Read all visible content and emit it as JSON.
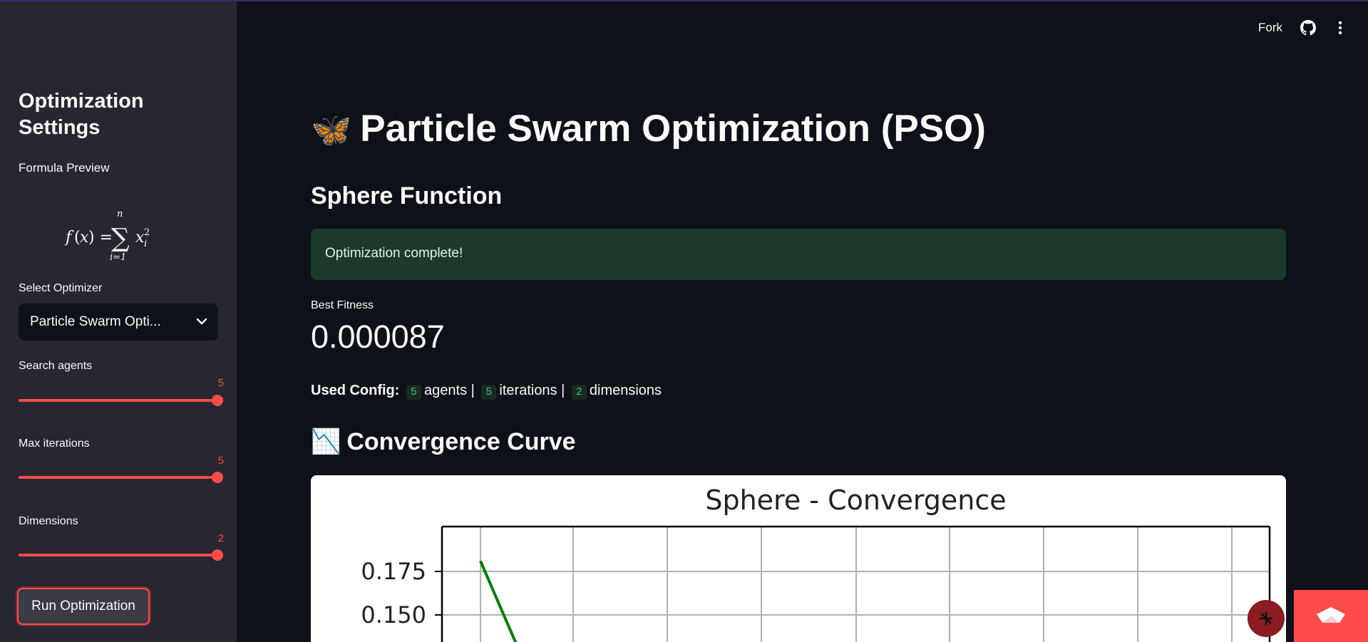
{
  "header": {
    "fork_label": "Fork"
  },
  "sidebar": {
    "title": "Optimization Settings",
    "formula_label": "Formula Preview",
    "select_label": "Select Optimizer",
    "select_value": "Particle Swarm Opti...",
    "sliders": [
      {
        "label": "Search agents",
        "value": "5"
      },
      {
        "label": "Max iterations",
        "value": "5"
      },
      {
        "label": "Dimensions",
        "value": "2"
      }
    ],
    "run_button": "Run Optimization"
  },
  "main": {
    "title_emoji": "🦋",
    "title": "Particle Swarm Optimization (PSO)",
    "subtitle": "Sphere Function",
    "alert": "Optimization complete!",
    "metric_label": "Best Fitness",
    "metric_value": "0.000087",
    "config": {
      "label": "Used Config:",
      "agents": "5",
      "agents_label": "agents |",
      "iterations": "5",
      "iterations_label": "iterations |",
      "dimensions": "2",
      "dimensions_label": "dimensions"
    },
    "section_emoji": "📉",
    "section_title": "Convergence Curve"
  },
  "chart_data": {
    "type": "line",
    "title": "Sphere - Convergence",
    "yticks": [
      "0.175",
      "0.150"
    ],
    "x": [
      0
    ],
    "series": [
      {
        "values": [
          0.181
        ],
        "color": "#008000"
      }
    ],
    "grid": true
  },
  "colors": {
    "accent": "#ff4b4b",
    "background": "#0e1117",
    "sidebar": "#262730",
    "success_bg": "#1b3a2a"
  },
  "icons": {
    "github": "github-icon",
    "menu": "kebab-menu-icon",
    "fab": "streamlit-fab-icon",
    "deploy": "streamlit-boat-icon"
  }
}
